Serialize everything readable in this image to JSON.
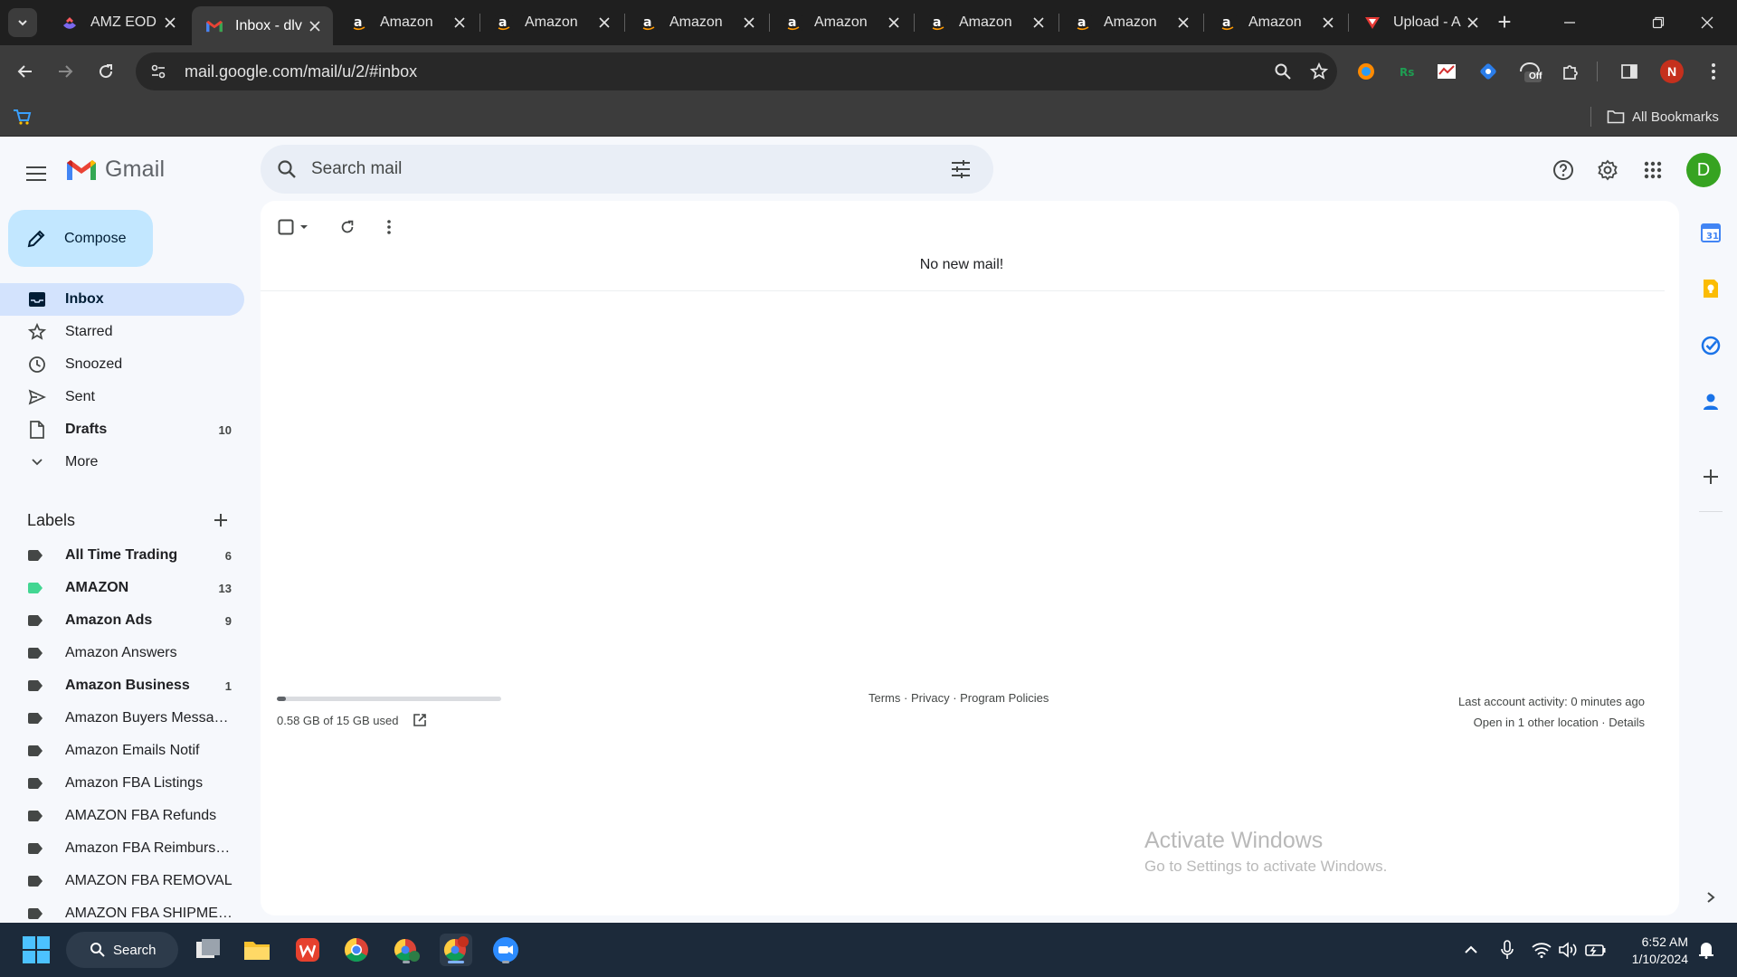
{
  "browser": {
    "tabs": [
      {
        "title": "AMZ EOD R",
        "favicon": "clickup-icon",
        "active": false
      },
      {
        "title": "Inbox - dlv",
        "favicon": "gmail-icon",
        "active": true
      },
      {
        "title": "Amazon",
        "favicon": "amazon-icon",
        "active": false
      },
      {
        "title": "Amazon",
        "favicon": "amazon-icon",
        "active": false
      },
      {
        "title": "Amazon",
        "favicon": "amazon-icon",
        "active": false
      },
      {
        "title": "Amazon",
        "favicon": "amazon-icon",
        "active": false
      },
      {
        "title": "Amazon",
        "favicon": "amazon-icon",
        "active": false
      },
      {
        "title": "Amazon",
        "favicon": "amazon-icon",
        "active": false
      },
      {
        "title": "Amazon",
        "favicon": "amazon-icon",
        "active": false
      },
      {
        "title": "Upload - A",
        "favicon": "upload-icon",
        "active": false
      }
    ],
    "url": "mail.google.com/mail/u/2/#inbox",
    "profile_initial": "N",
    "all_bookmarks_label": "All Bookmarks",
    "extension_off_badge": "Off"
  },
  "gmail": {
    "logo_text": "Gmail",
    "search_placeholder": "Search mail",
    "avatar_initial": "D",
    "compose_label": "Compose",
    "nav": [
      {
        "label": "Inbox",
        "icon": "inbox-icon",
        "count": "",
        "active": true
      },
      {
        "label": "Starred",
        "icon": "star-icon",
        "count": "",
        "active": false
      },
      {
        "label": "Snoozed",
        "icon": "clock-icon",
        "count": "",
        "active": false
      },
      {
        "label": "Sent",
        "icon": "send-icon",
        "count": "",
        "active": false
      },
      {
        "label": "Drafts",
        "icon": "draft-icon",
        "count": "10",
        "active": false
      },
      {
        "label": "More",
        "icon": "chevron-down-icon",
        "count": "",
        "active": false
      }
    ],
    "labels_heading": "Labels",
    "labels": [
      {
        "name": "All Time Trading",
        "count": "6",
        "color": "#444746",
        "bold": true
      },
      {
        "name": "AMAZON",
        "count": "13",
        "color": "#43d692",
        "bold": true
      },
      {
        "name": "Amazon Ads",
        "count": "9",
        "color": "#444746",
        "bold": true
      },
      {
        "name": "Amazon Answers",
        "count": "",
        "color": "#444746",
        "bold": false
      },
      {
        "name": "Amazon Business",
        "count": "1",
        "color": "#444746",
        "bold": true
      },
      {
        "name": "Amazon Buyers Messag...",
        "count": "",
        "color": "#444746",
        "bold": false
      },
      {
        "name": "Amazon Emails Notif",
        "count": "",
        "color": "#444746",
        "bold": false
      },
      {
        "name": "Amazon FBA Listings",
        "count": "",
        "color": "#444746",
        "bold": false
      },
      {
        "name": "AMAZON FBA Refunds",
        "count": "",
        "color": "#444746",
        "bold": false
      },
      {
        "name": "Amazon FBA Reimburse...",
        "count": "",
        "color": "#444746",
        "bold": false
      },
      {
        "name": "AMAZON FBA REMOVAL",
        "count": "",
        "color": "#444746",
        "bold": false
      },
      {
        "name": "AMAZON FBA SHIPMEN...",
        "count": "",
        "color": "#444746",
        "bold": false
      }
    ],
    "main": {
      "empty_message": "No new mail!",
      "storage_text": "0.58 GB of 15 GB used",
      "storage_fraction": 0.039,
      "footer_terms": "Terms",
      "footer_privacy": "Privacy",
      "footer_policies": "Program Policies",
      "footer_sep": " · ",
      "last_activity": "Last account activity: 0 minutes ago",
      "other_location": "Open in 1 other location",
      "details": "Details"
    }
  },
  "watermark": {
    "line1": "Activate Windows",
    "line2": "Go to Settings to activate Windows."
  },
  "taskbar": {
    "search_label": "Search",
    "time": "6:52 AM",
    "date": "1/10/2024"
  },
  "colors": {
    "compose_bg": "#c2e7ff",
    "active_nav_bg": "#d3e3fd",
    "avatar_bg": "#36a321",
    "gmail_bg": "#f6f8fc"
  }
}
